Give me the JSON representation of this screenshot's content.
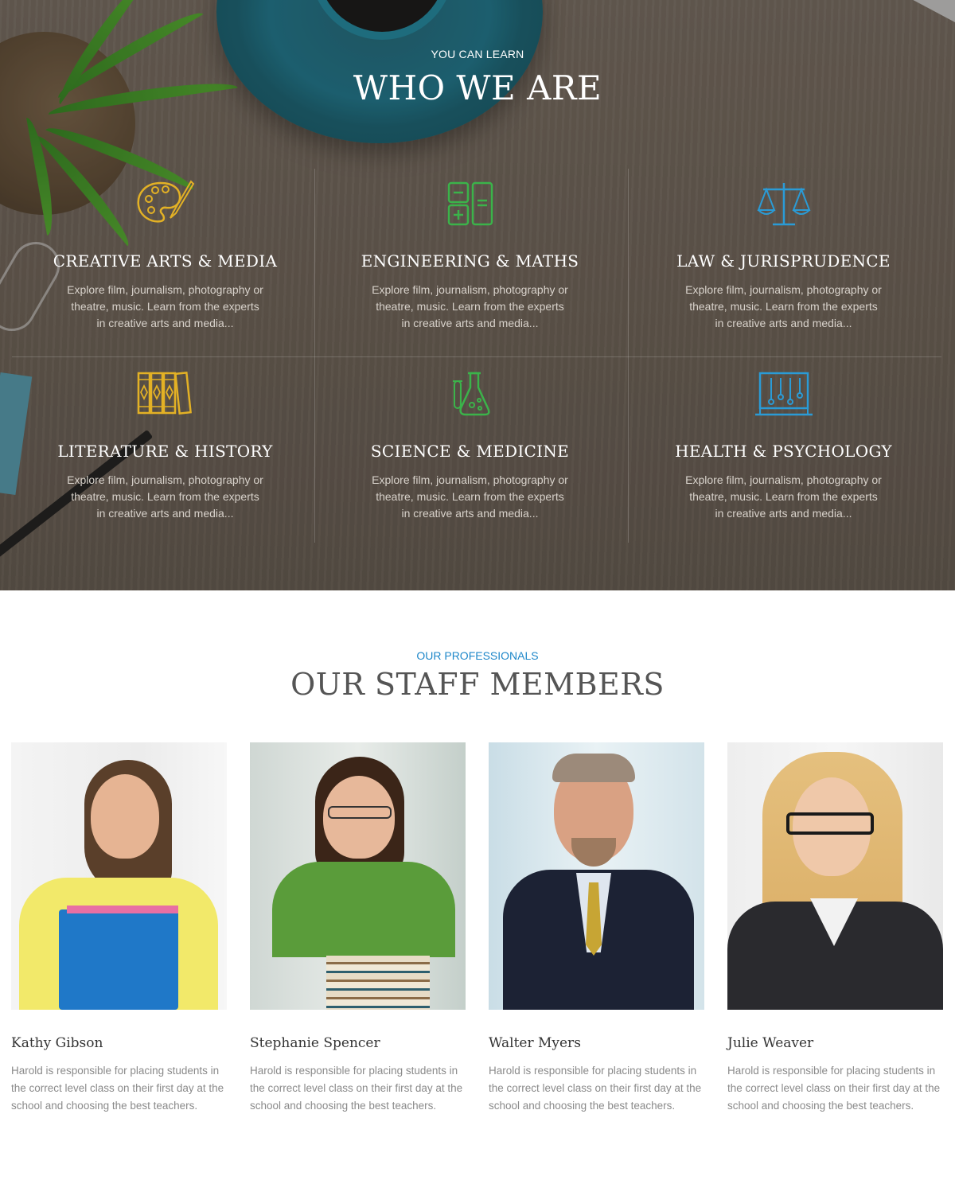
{
  "hero": {
    "kicker": "YOU CAN LEARN",
    "title": "WHO WE ARE",
    "categories": [
      {
        "title": "CREATIVE ARTS & MEDIA",
        "icon": "palette-icon",
        "color": "#e3b125",
        "lines": [
          "Explore film, journalism, photography or",
          "theatre, music. Learn from the experts",
          "in creative arts and media..."
        ]
      },
      {
        "title": "ENGINEERING & MATHS",
        "icon": "calculator-icon",
        "color": "#3bb34a",
        "lines": [
          "Explore film, journalism, photography or",
          "theatre, music. Learn from the experts",
          "in creative arts and media..."
        ]
      },
      {
        "title": "LAW & JURISPRUDENCE",
        "icon": "scales-icon",
        "color": "#2a9bd6",
        "lines": [
          "Explore film, journalism, photography or",
          "theatre, music. Learn from the experts",
          "in creative arts and media..."
        ]
      },
      {
        "title": "LITERATURE & HISTORY",
        "icon": "books-icon",
        "color": "#e3b125",
        "lines": [
          "Explore film, journalism, photography or",
          "theatre, music. Learn from the experts",
          "in creative arts and media..."
        ]
      },
      {
        "title": "SCIENCE & MEDICINE",
        "icon": "flask-icon",
        "color": "#3bb34a",
        "lines": [
          "Explore film, journalism, photography or",
          "theatre, music. Learn from the experts",
          "in creative arts and media..."
        ]
      },
      {
        "title": "HEALTH & PSYCHOLOGY",
        "icon": "abacus-icon",
        "color": "#2a9bd6",
        "lines": [
          "Explore film, journalism, photography or",
          "theatre, music. Learn from the experts",
          "in creative arts and media..."
        ]
      }
    ]
  },
  "staff": {
    "kicker": "OUR PROFESSIONALS",
    "title": "OUR STAFF MEMBERS",
    "members": [
      {
        "name": "Kathy Gibson",
        "bio_lines": [
          "Harold is responsible for placing students in",
          "the correct level class on their first day at the",
          "school and choosing the best teachers."
        ]
      },
      {
        "name": "Stephanie Spencer",
        "bio_lines": [
          "Harold is responsible for placing students in",
          "the correct level class on their first day at the",
          "school and choosing the best teachers."
        ]
      },
      {
        "name": "Walter Myers",
        "bio_lines": [
          "Harold is responsible for placing students in",
          "the correct level class on their first day at the",
          "school and choosing the best teachers."
        ]
      },
      {
        "name": "Julie Weaver",
        "bio_lines": [
          "Harold is responsible for placing students in",
          "the correct level class on their first day at the",
          "school and choosing the best teachers."
        ]
      }
    ]
  },
  "colors": {
    "accent": "#1e87c9",
    "yellow": "#e3b125",
    "green": "#3bb34a",
    "blue": "#2a9bd6"
  }
}
